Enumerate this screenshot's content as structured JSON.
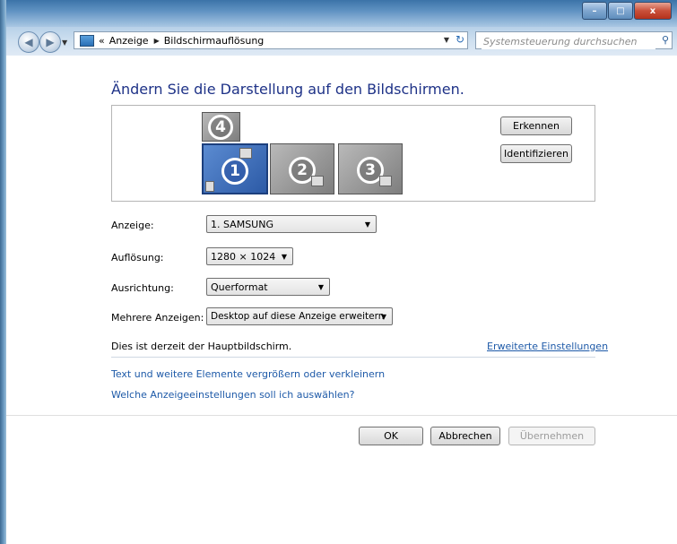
{
  "window": {
    "caption_buttons": [
      "–",
      "□",
      "x"
    ]
  },
  "navigation": {
    "breadcrumb_prefix": "«",
    "crumbs": [
      "Anzeige",
      "Bildschirmauflösung"
    ],
    "search_placeholder": "Systemsteuerung durchsuchen"
  },
  "main": {
    "heading": "Ändern Sie die Darstellung auf den Bildschirmen.",
    "monitors": [
      "1",
      "2",
      "3",
      "4"
    ],
    "detect_button": "Erkennen",
    "identify_button": "Identifizieren",
    "display_label": "Anzeige:",
    "display_value": "1. SAMSUNG",
    "resolution_label": "Auflösung:",
    "resolution_value": "1280 × 1024",
    "orientation_label": "Ausrichtung:",
    "orientation_value": "Querformat",
    "multi_label": "Mehrere Anzeigen:",
    "multi_value": "Desktop auf diese Anzeige erweitern",
    "primary_text": "Dies ist derzeit der Hauptbildschirm.",
    "advanced_link": "Erweiterte Einstellungen",
    "link_text_size": "Text und weitere Elemente vergrößern oder verkleinern",
    "link_which_settings": "Welche Anzeigeeinstellungen soll ich auswählen?"
  },
  "footer": {
    "ok": "OK",
    "cancel": "Abbrechen",
    "apply": "Übernehmen"
  },
  "colors": {
    "heading": "#1e3287",
    "link": "#1e5aa8",
    "selected_monitor": "#2c5aa6"
  }
}
